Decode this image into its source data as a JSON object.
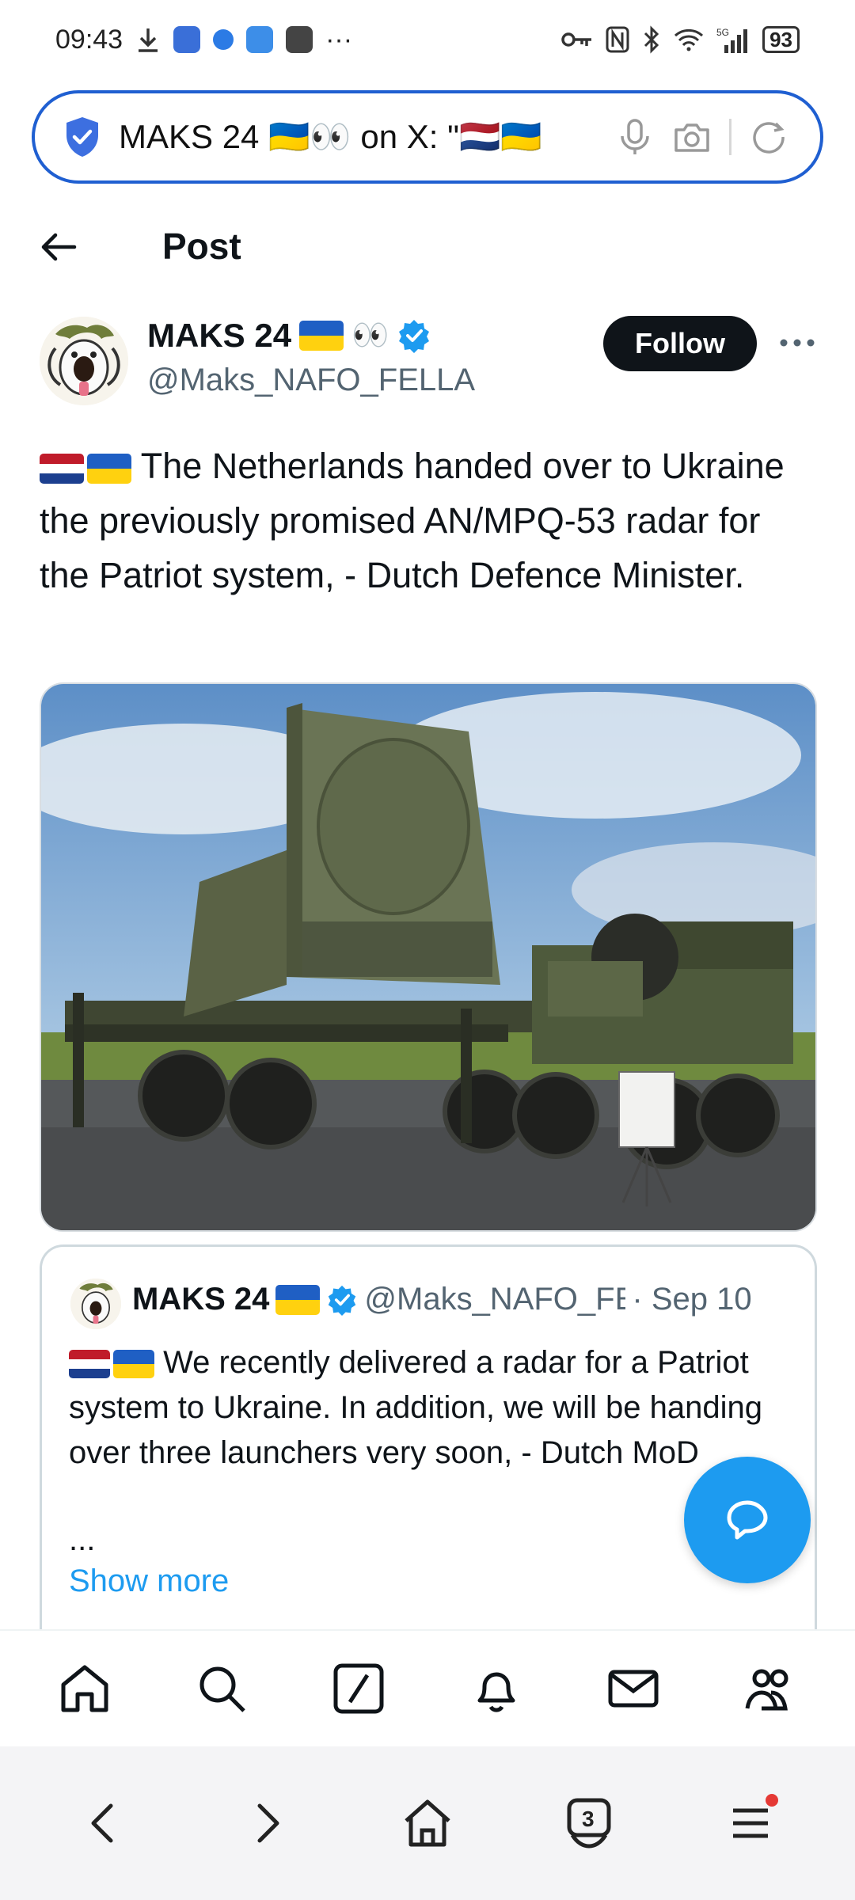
{
  "status_bar": {
    "time": "09:43",
    "dots": "···",
    "battery": "93",
    "network": "5G"
  },
  "address_bar": {
    "url": "MAKS 24 🇺🇦👀 on X: \"🇳🇱🇺🇦"
  },
  "header": {
    "title": "Post"
  },
  "post": {
    "author_name": "MAKS 24",
    "author_handle": "@Maks_NAFO_FELLA",
    "eyes": "👀",
    "follow_label": "Follow",
    "text": "The Netherlands handed over to Ukraine the previously promised AN/MPQ-53 radar for the Patriot system, - Dutch Defence Minister."
  },
  "quote": {
    "author_name": "MAKS 24",
    "author_handle": "@Maks_NAFO_FEl",
    "date": "· Sep 10",
    "text": "We recently delivered a radar for a Patriot system to Ukraine. In addition, we will be handing over three launchers very soon, - Dutch MoD",
    "ellipsis": "...",
    "show_more": "Show more"
  },
  "bottom_nav": {
    "items": [
      "home",
      "search",
      "grok",
      "notifications",
      "messages",
      "communities"
    ]
  },
  "browser_bar": {
    "tab_count": "3"
  },
  "colors": {
    "accent": "#1d9bf0",
    "follow_bg": "#0f1419",
    "address_border": "#1f5fd1"
  }
}
